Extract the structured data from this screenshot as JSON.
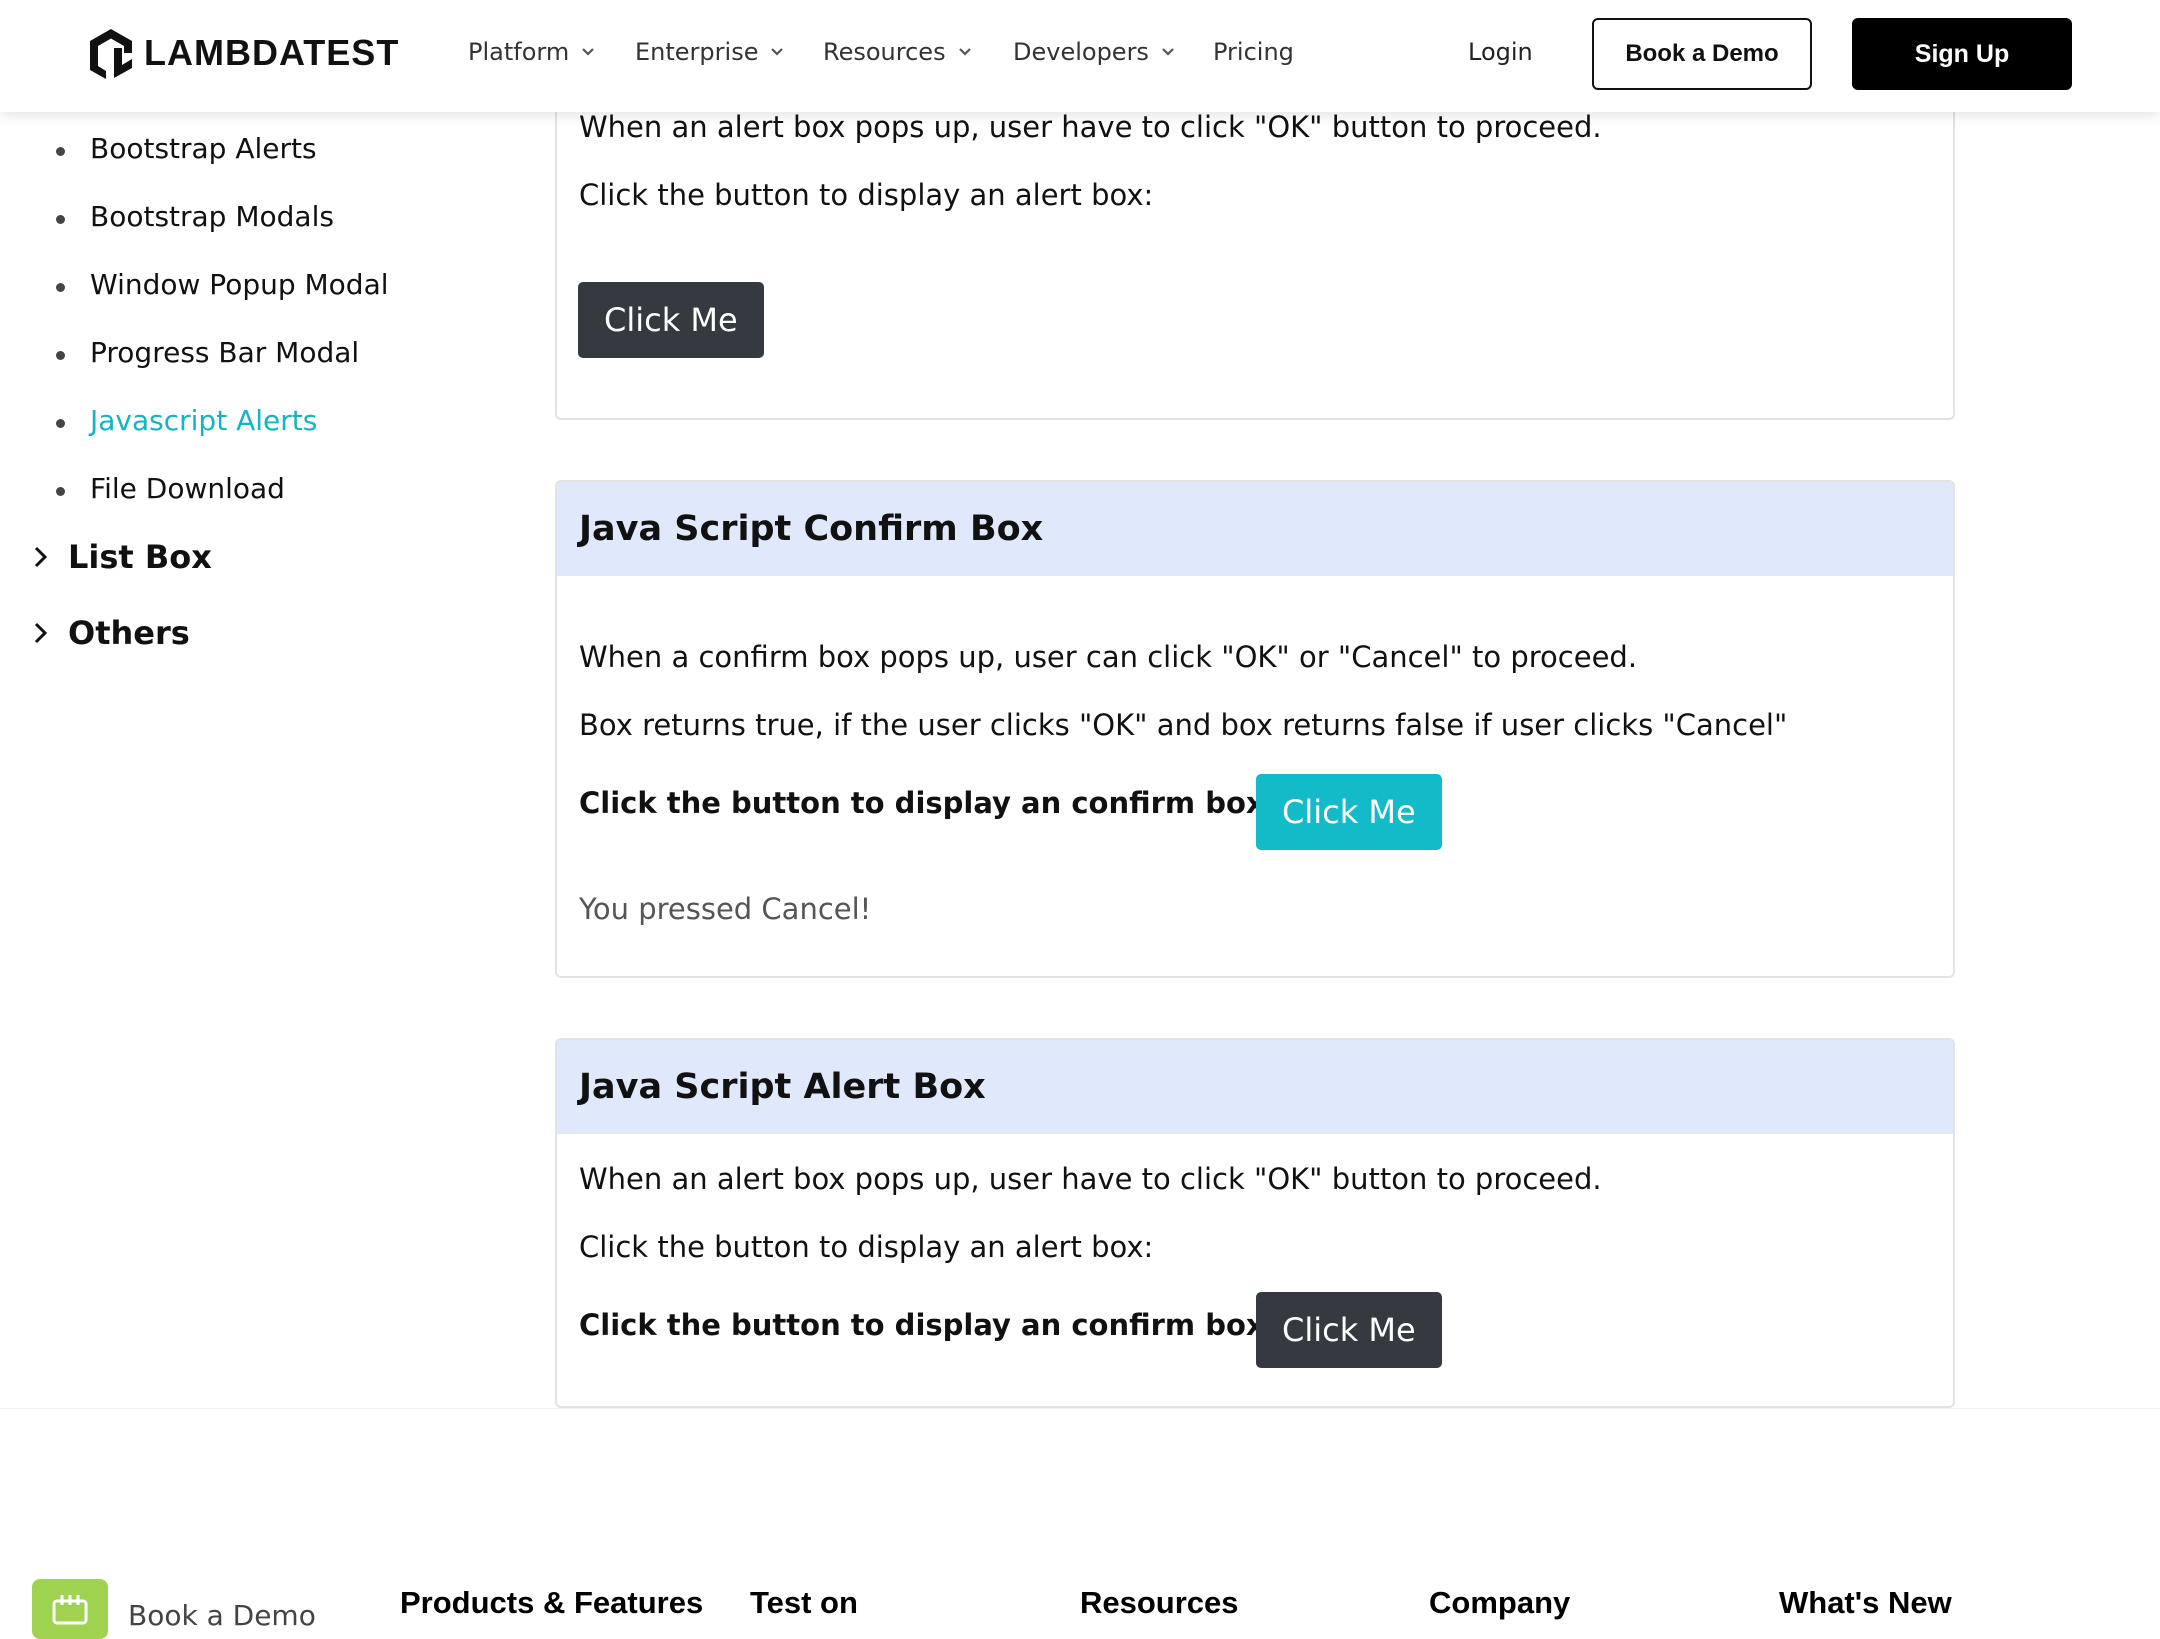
{
  "nav": {
    "brand": "LAMBDATEST",
    "items": [
      "Platform",
      "Enterprise",
      "Resources",
      "Developers",
      "Pricing"
    ],
    "login": "Login",
    "book_demo": "Book a Demo",
    "sign_up": "Sign Up"
  },
  "sidebar": {
    "items": [
      "Bootstrap Alerts",
      "Bootstrap Modals",
      "Window Popup Modal",
      "Progress Bar Modal",
      "Javascript Alerts",
      "File Download"
    ],
    "active_index": 4,
    "groups": [
      "List Box",
      "Others"
    ],
    "accent_color": "#13b5c1"
  },
  "alert_top": {
    "line1": "When an alert box pops up, user have to click \"OK\" button to proceed.",
    "line2": "Click the button to display an alert box:",
    "button": "Click Me"
  },
  "confirm_box": {
    "title": "Java Script Confirm Box",
    "line1": "When a confirm box pops up, user can click \"OK\" or \"Cancel\" to proceed.",
    "line2": "Box returns true, if the user clicks \"OK\" and box returns false if user clicks \"Cancel\"",
    "prompt": "Click the button to display an confirm box:",
    "button": "Click Me",
    "result": "You pressed Cancel!"
  },
  "alert_box": {
    "title": "Java Script Alert Box",
    "line1": "When an alert box pops up, user have to click \"OK\" button to proceed.",
    "line2": "Click the button to display an alert box:",
    "prompt": "Click the button to display an confirm box:",
    "button": "Click Me"
  },
  "footer": {
    "book_demo": "Book a Demo",
    "columns": [
      "Products & Features",
      "Test on",
      "Resources",
      "Company",
      "What's New"
    ]
  }
}
